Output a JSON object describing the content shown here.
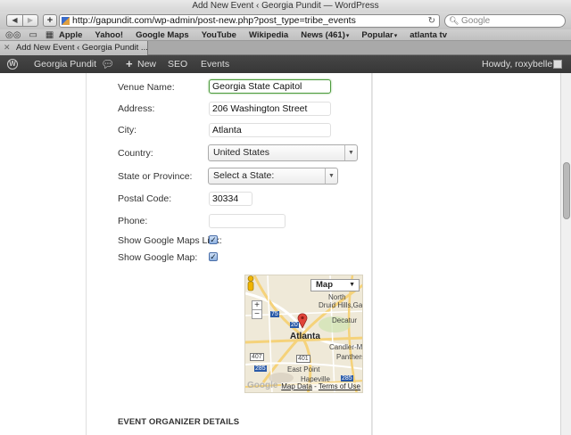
{
  "window": {
    "title": "Add New Event ‹ Georgia Pundit — WordPress"
  },
  "toolbar": {
    "back": "◀",
    "forward": "▶",
    "add": "+",
    "url": "http://gapundit.com/wp-admin/post-new.php?post_type=tribe_events",
    "reload": "↻",
    "search_placeholder": "Google"
  },
  "bookmarks": {
    "items": [
      "Apple",
      "Yahoo!",
      "Google Maps",
      "YouTube",
      "Wikipedia",
      "News (461)",
      "Popular",
      "atlanta tv"
    ]
  },
  "tabs": [
    {
      "label": "Add New Event ‹ Georgia Pundit ..."
    }
  ],
  "adminbar": {
    "site": "Georgia Pundit",
    "new": "New",
    "seo": "SEO",
    "events": "Events",
    "greeting": "Howdy, roxybelle"
  },
  "venue": {
    "name_label": "Venue Name:",
    "name_value": "Georgia State Capitol",
    "address_label": "Address:",
    "address_value": "206 Washington Street",
    "city_label": "City:",
    "city_value": "Atlanta",
    "country_label": "Country:",
    "country_value": "United States",
    "state_label": "State or Province:",
    "state_value": "Select a State:",
    "postal_label": "Postal Code:",
    "postal_value": "30334",
    "phone_label": "Phone:",
    "phone_value": "",
    "maps_link_label": "Show Google Maps Link:",
    "maps_link_checked": true,
    "map_label": "Show Google Map:",
    "map_checked": true
  },
  "map": {
    "type": "Map",
    "zoom_in": "+",
    "zoom_out": "−",
    "city": "Atlanta",
    "labels": {
      "north": "North",
      "druid": "Druid Hills,Ga",
      "decatur": "Decatur",
      "candler": "Candler-Mc",
      "panthers": "Panthers",
      "east_point": "East Point",
      "hapeville": "Hapeville"
    },
    "shields": {
      "i75": "75",
      "i20": "20",
      "r407": "407",
      "r401": "401",
      "i285a": "285",
      "i285b": "285"
    },
    "logo": "Google",
    "map_data": "Map Data",
    "separator": " - ",
    "terms": "Terms of Use"
  },
  "organizer": {
    "title": "EVENT ORGANIZER DETAILS"
  }
}
